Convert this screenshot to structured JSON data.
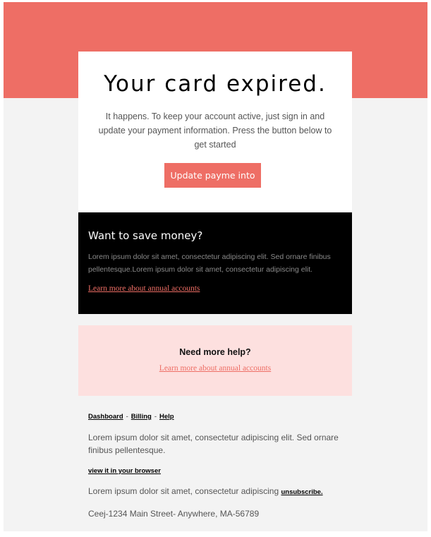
{
  "colors": {
    "brand": "#ee6e65",
    "background": "#f3f3f3",
    "promo_bg": "#000000",
    "help_bg": "#fde0df"
  },
  "hero": {
    "title": "Your card expired.",
    "body": "It happens. To keep your account active, just sign in and update your payment information. Press the button below to get started",
    "cta_label": "Update payme into"
  },
  "promo": {
    "title": "Want to save money?",
    "body": "Lorem ipsum dolor sit amet, consectetur adipiscing elit. Sed ornare finibus pellentesque.Lorem ipsum dolor sit amet, consectetur adipiscing elit.",
    "link": "Learn more about annual accounts"
  },
  "help": {
    "title": "Need more help?",
    "link": "Learn more about annual accounts"
  },
  "footer": {
    "nav": {
      "dashboard": "Dashboard",
      "billing": "Billing",
      "help": "Help",
      "separator": "-"
    },
    "blurb": "Lorem ipsum dolor sit amet, consectetur adipiscing elit. Sed ornare finibus pellentesque.",
    "browser_link": "view it in your browser",
    "unsub_text": "Lorem ipsum dolor sit amet, consectetur adipiscing",
    "unsub_link": "unsubscribe.",
    "address": "Ceej-1234 Main Street- Anywhere, MA-56789"
  }
}
